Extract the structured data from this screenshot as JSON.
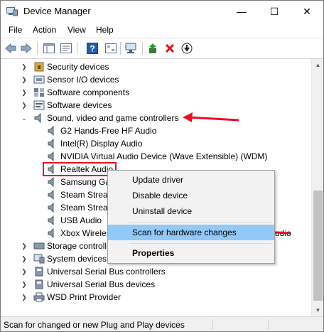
{
  "window": {
    "title": "Device Manager"
  },
  "menu": [
    "File",
    "Action",
    "View",
    "Help"
  ],
  "tree": {
    "categories_top": [
      {
        "label": "Security devices",
        "icon": "security-device-icon"
      },
      {
        "label": "Sensor I/O devices",
        "icon": "sensor-icon"
      },
      {
        "label": "Software components",
        "icon": "software-component-icon"
      },
      {
        "label": "Software devices",
        "icon": "software-device-icon"
      }
    ],
    "expanded": {
      "label": "Sound, video and game controllers",
      "children": [
        "G2 Hands-Free HF Audio",
        "Intel(R) Display Audio",
        "NVIDIA Virtual Audio Device (Wave Extensible) (WDM)",
        "Realtek Audio",
        "Samsung Ga",
        "Steam Strea",
        "Steam Strea",
        "USB Audio",
        "Xbox Wireles"
      ],
      "clipped_suffix": "udio"
    },
    "categories_bottom": [
      {
        "label": "Storage controll",
        "icon": "storage-controller-icon"
      },
      {
        "label": "System devices",
        "icon": "system-devices-icon"
      },
      {
        "label": "Universal Serial Bus controllers",
        "icon": "usb-controller-icon"
      },
      {
        "label": "Universal Serial Bus devices",
        "icon": "usb-device-icon"
      },
      {
        "label": "WSD Print Provider",
        "icon": "printer-icon"
      }
    ]
  },
  "context_menu": {
    "items": [
      "Update driver",
      "Disable device",
      "Uninstall device",
      "Scan for hardware changes",
      "Properties"
    ]
  },
  "status": {
    "text": "Scan for changed or new Plug and Play devices"
  },
  "colors": {
    "annotation": "#e81123",
    "menu_highlight": "#91c9f7"
  }
}
